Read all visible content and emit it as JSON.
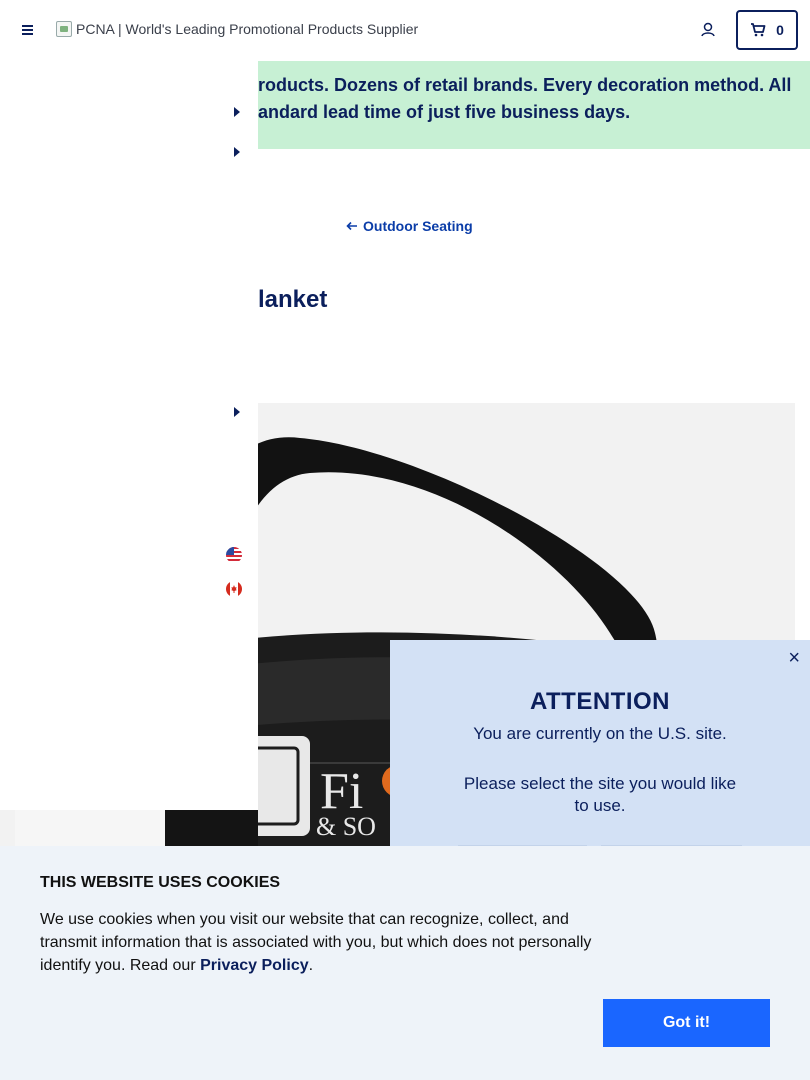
{
  "header": {
    "logo_alt": "PCNA | World's Leading Promotional Products Supplier",
    "cart_count": "0",
    "menu_icon": "hamburger-icon",
    "account_icon": "user-icon",
    "cart_icon": "cart-icon"
  },
  "promo": {
    "line1": "roducts. Dozens of retail brands. Every decoration method. All",
    "line2": "andard lead time of just five business days."
  },
  "breadcrumb": {
    "back_label": "Outdoor Seating",
    "back_icon": "arrow-left-icon"
  },
  "product": {
    "title_fragment": "lanket",
    "logo_text_1": "Fi",
    "logo_text_2": "& SO"
  },
  "drawer": {
    "flags": [
      "us-flag-icon",
      "canada-flag-icon"
    ]
  },
  "attention": {
    "title": "ATTENTION",
    "message1": "You are currently on the U.S. site.",
    "message2": "Please select the site you would like to use.",
    "close_label": "×"
  },
  "cookie": {
    "title": "THIS WEBSITE USES COOKIES",
    "text_before": "We use cookies when you visit our website that can recognize, collect, and transmit information that is associated with you, but which does not personally identify you. Read our ",
    "link_label": "Privacy Policy",
    "text_after": ".",
    "button_label": "Got it!"
  },
  "colors": {
    "navy": "#0b1f5c",
    "promo_bg": "#c7f0d4",
    "modal_bg": "#d3e1f5",
    "cookie_bg": "#eef3f9",
    "button_blue": "#1a66ff"
  }
}
